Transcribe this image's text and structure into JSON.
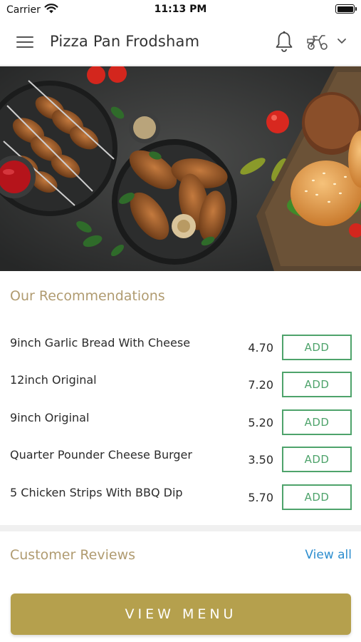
{
  "status_bar": {
    "carrier": "Carrier",
    "time": "11:13 PM"
  },
  "header": {
    "title": "Pizza Pan Frodsham",
    "icons": [
      "menu-icon",
      "bell-icon",
      "scooter-icon",
      "chevron-down-icon"
    ]
  },
  "hero": {
    "icon": "food-banner-image"
  },
  "recommendations": {
    "title": "Our Recommendations",
    "items": [
      {
        "name": "9inch Garlic Bread With Cheese",
        "price": "4.70",
        "add_label": "ADD"
      },
      {
        "name": "12inch Original",
        "price": "7.20",
        "add_label": "ADD"
      },
      {
        "name": "9inch Original",
        "price": "5.20",
        "add_label": "ADD"
      },
      {
        "name": "Quarter Pounder Cheese Burger",
        "price": "3.50",
        "add_label": "ADD"
      },
      {
        "name": "5 Chicken Strips With BBQ Dip",
        "price": "5.70",
        "add_label": "ADD"
      }
    ]
  },
  "reviews": {
    "title": "Customer Reviews",
    "view_all_label": "View all"
  },
  "footer": {
    "view_menu_label": "VIEW MENU"
  },
  "colors": {
    "accent_gold": "#b5a04d",
    "section_title": "#b09b70",
    "add_green": "#4ea36b",
    "link_blue": "#2d8ecf"
  }
}
